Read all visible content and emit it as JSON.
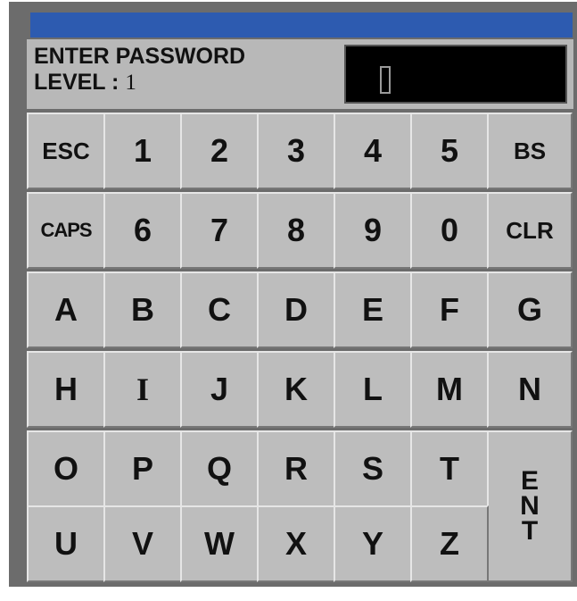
{
  "header": {
    "prompt": "ENTER PASSWORD",
    "level_label": "LEVEL :",
    "level_value": "1"
  },
  "password": {
    "value": ""
  },
  "keys": {
    "esc": "ESC",
    "bs": "BS",
    "caps": "CAPS",
    "clr": "CLR",
    "digits": [
      "1",
      "2",
      "3",
      "4",
      "5",
      "6",
      "7",
      "8",
      "9",
      "0"
    ],
    "letters": [
      "A",
      "B",
      "C",
      "D",
      "E",
      "F",
      "G",
      "H",
      "I",
      "J",
      "K",
      "L",
      "M",
      "N",
      "O",
      "P",
      "Q",
      "R",
      "S",
      "T",
      "U",
      "V",
      "W",
      "X",
      "Y",
      "Z"
    ],
    "enter": [
      "E",
      "N",
      "T"
    ]
  },
  "colors": {
    "titlebar": "#2d5bb0",
    "key_face": "#bdbdbd",
    "field": "#000000"
  }
}
